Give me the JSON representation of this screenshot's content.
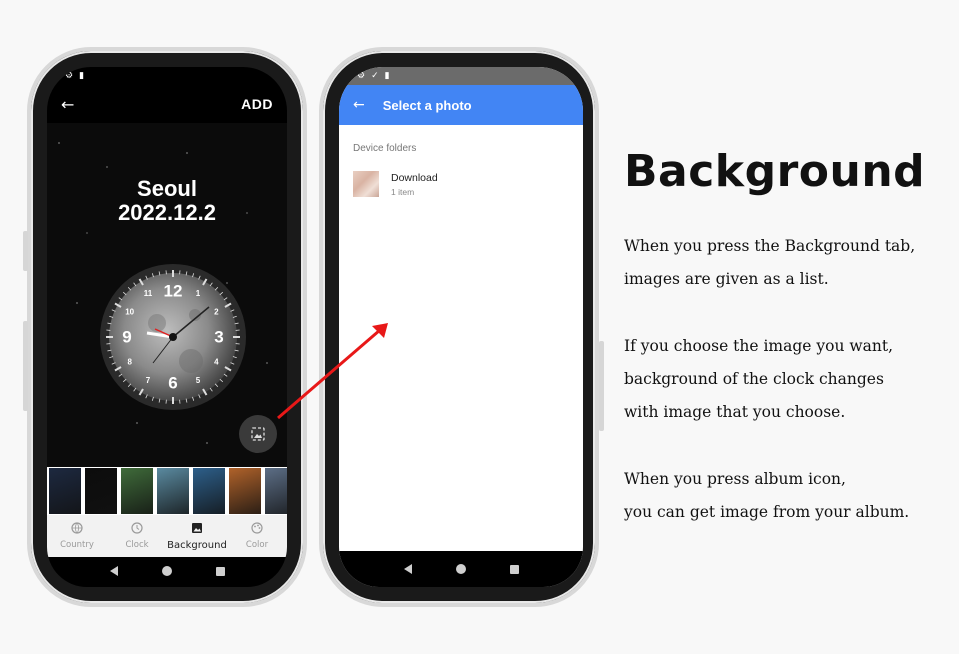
{
  "phone1": {
    "add_label": "ADD",
    "city": "Seoul",
    "date": "2022.12.2",
    "clock_numbers": [
      "12",
      "1",
      "2",
      "3",
      "4",
      "5",
      "6",
      "7",
      "8",
      "9",
      "10",
      "11"
    ],
    "tabs": [
      {
        "label": "Country",
        "icon": "globe-icon",
        "active": false
      },
      {
        "label": "Clock",
        "icon": "clock-icon",
        "active": false
      },
      {
        "label": "Background",
        "icon": "image-icon",
        "active": true
      },
      {
        "label": "Color",
        "icon": "palette-icon",
        "active": false
      }
    ],
    "thumbnails": [
      "#1d2940",
      "#0c0c0c",
      "#3f6b3a",
      "#5a8aa0",
      "#2d5f8a",
      "#b0622a",
      "#5c6e86"
    ]
  },
  "phone2": {
    "title": "Select a photo",
    "section": "Device folders",
    "folder_name": "Download",
    "folder_count": "1 item",
    "accent": "#4285f4"
  },
  "panel": {
    "heading": "Background",
    "p1_line1": "When you press the Background tab,",
    "p1_line2": "images are given as a list.",
    "p2_line1": "If you choose the image you want,",
    "p2_line2": "background of the clock changes",
    "p2_line3": "with image that you choose.",
    "p3_line1": "When you press album icon,",
    "p3_line2": "you can get image from your album."
  }
}
